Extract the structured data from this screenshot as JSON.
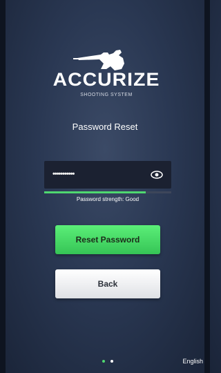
{
  "logo": {
    "word": "ACCURIZE",
    "tagline": "SHOOTING SYSTEM",
    "icon": "shooter-silhouette-icon"
  },
  "form": {
    "title": "Password Reset",
    "password_value": "•••••••••••",
    "toggle_icon": "eye-icon",
    "strength_label": "Password strength: Good",
    "strength_level": 0.8
  },
  "buttons": {
    "reset_label": "Reset Password",
    "back_label": "Back"
  },
  "footer": {
    "language": "English",
    "page_dots": 2,
    "active_dot": 1
  },
  "colors": {
    "accent_green": "#4fd870",
    "background": "#2a3853"
  }
}
